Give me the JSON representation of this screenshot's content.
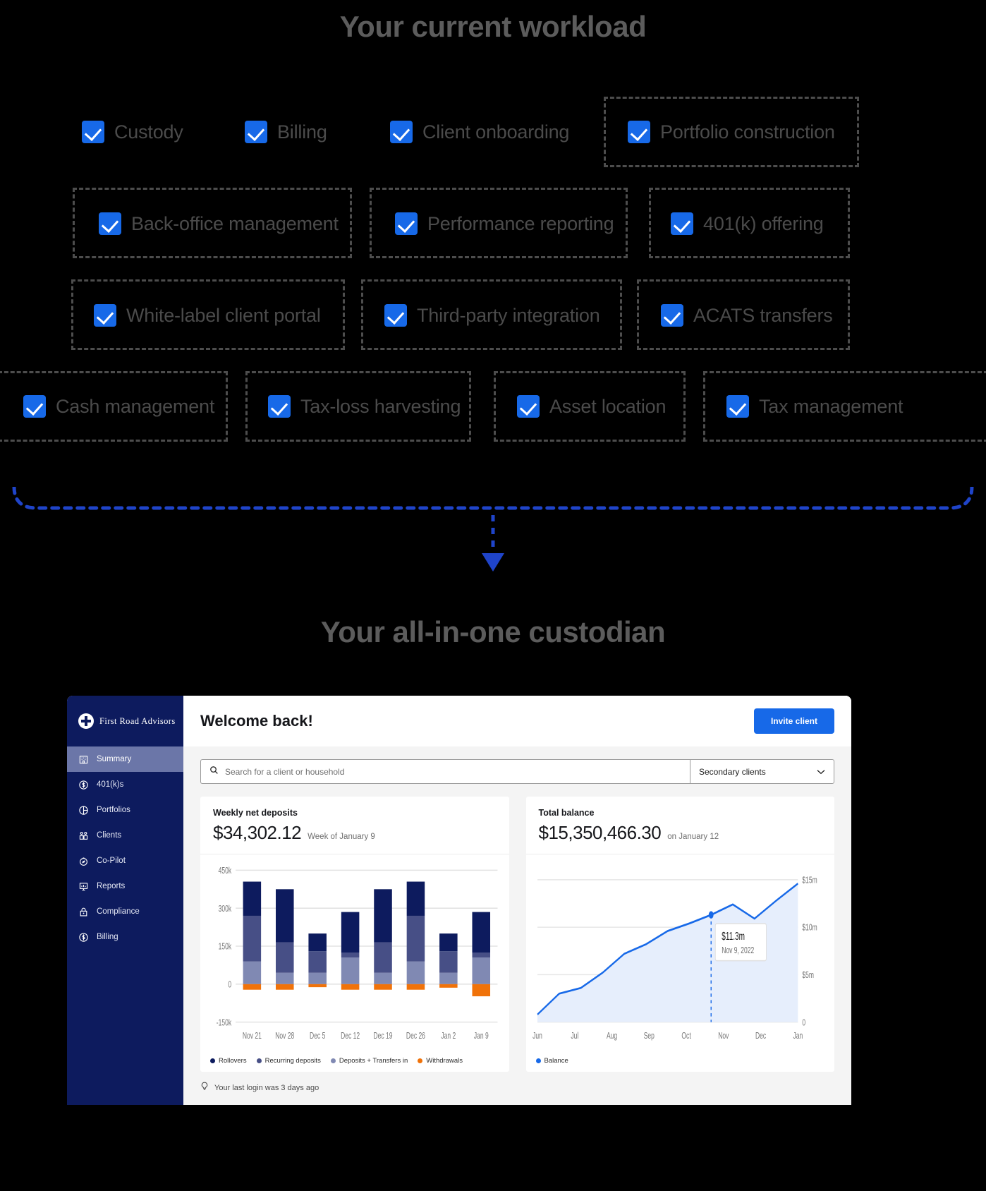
{
  "headings": {
    "workload": "Your current workload",
    "custodian": "Your all-in-one custodian"
  },
  "workload_items": [
    {
      "label": "Custody",
      "boxed": false
    },
    {
      "label": "Billing",
      "boxed": false
    },
    {
      "label": "Client onboarding",
      "boxed": false
    },
    {
      "label": "Portfolio construction",
      "boxed": true
    },
    {
      "label": "Back-office management",
      "boxed": true
    },
    {
      "label": "Performance reporting",
      "boxed": true
    },
    {
      "label": "401(k) offering",
      "boxed": true
    },
    {
      "label": "White-label client portal",
      "boxed": true
    },
    {
      "label": "Third-party integration",
      "boxed": true
    },
    {
      "label": "ACATS transfers",
      "boxed": true
    },
    {
      "label": "Cash management",
      "boxed": true
    },
    {
      "label": "Tax-loss harvesting",
      "boxed": true
    },
    {
      "label": "Asset location",
      "boxed": true
    },
    {
      "label": "Tax management",
      "boxed": true
    }
  ],
  "app": {
    "brand": "First Road Advisors",
    "sidebar": [
      {
        "label": "Summary",
        "icon": "building-icon",
        "active": true
      },
      {
        "label": "401(k)s",
        "icon": "dollar-circle-icon",
        "active": false
      },
      {
        "label": "Portfolios",
        "icon": "pie-chart-icon",
        "active": false
      },
      {
        "label": "Clients",
        "icon": "people-icon",
        "active": false
      },
      {
        "label": "Co-Pilot",
        "icon": "compass-icon",
        "active": false
      },
      {
        "label": "Reports",
        "icon": "presentation-icon",
        "active": false
      },
      {
        "label": "Compliance",
        "icon": "lock-icon",
        "active": false
      },
      {
        "label": "Billing",
        "icon": "dollar-circle-icon",
        "active": false
      }
    ],
    "header": {
      "welcome": "Welcome back!",
      "invite_label": "Invite client"
    },
    "search": {
      "placeholder": "Search for a client or household",
      "icon": "search-icon",
      "filter_value": "Secondary clients",
      "filter_icon": "chevron-down-icon"
    },
    "footer": {
      "icon": "lightbulb-icon",
      "text": "Your last login was 3 days ago"
    },
    "colors": {
      "brand_navy": "#0d1b5e",
      "accent_blue": "#1769e8",
      "orange": "#f07209",
      "series_dark": "#0d1b5e",
      "series_mid": "#474f86",
      "series_light": "#8089b3"
    }
  },
  "chart_data": [
    {
      "type": "bar",
      "title": "Weekly net deposits",
      "value": "$34,302.12",
      "subtitle": "Week of January 9",
      "stacked": true,
      "categories": [
        "Nov 21",
        "Nov 28",
        "Dec 5",
        "Dec 12",
        "Dec 19",
        "Dec 26",
        "Jan 2",
        "Jan 9"
      ],
      "ylabel": "",
      "xlabel": "",
      "ytick_labels": [
        "450k",
        "300k",
        "150k",
        "0",
        "-150k"
      ],
      "ytick_values": [
        450000,
        300000,
        150000,
        0,
        -150000
      ],
      "ylim": [
        -150000,
        450000
      ],
      "grid": true,
      "legend_position": "bottom",
      "series": [
        {
          "name": "Deposits + Transfers in",
          "color": "#8089b3",
          "values": [
            90000,
            45000,
            45000,
            105000,
            45000,
            90000,
            45000,
            105000
          ]
        },
        {
          "name": "Recurring deposits",
          "color": "#474f86",
          "values": [
            180000,
            120000,
            85000,
            20000,
            120000,
            180000,
            85000,
            20000
          ]
        },
        {
          "name": "Rollovers",
          "color": "#0d1b5e",
          "values": [
            135000,
            210000,
            70000,
            160000,
            210000,
            135000,
            70000,
            160000
          ]
        },
        {
          "name": "Withdrawals",
          "color": "#f07209",
          "values": [
            -22000,
            -22000,
            -12000,
            -22000,
            -22000,
            -22000,
            -14000,
            -48000
          ]
        }
      ]
    },
    {
      "type": "area",
      "title": "Total balance",
      "value": "$15,350,466.30",
      "subtitle": "on January 12",
      "categories": [
        "Jun",
        "Jul",
        "Aug",
        "Sep",
        "Oct",
        "Nov",
        "Dec",
        "Jan"
      ],
      "ytick_labels": [
        "$15m",
        "$10m",
        "$5m",
        "0"
      ],
      "ytick_values": [
        15000000,
        10000000,
        5000000,
        0
      ],
      "ylim": [
        0,
        16000000
      ],
      "grid": true,
      "legend_position": "bottom",
      "legend": [
        {
          "name": "Balance",
          "color": "#1769e8"
        }
      ],
      "annotation": {
        "value": "$11.3m",
        "date": "Nov 9, 2022",
        "x_category": "Nov"
      },
      "series": [
        {
          "name": "Balance",
          "color": "#1769e8",
          "x": [
            "Jun",
            "Jun+",
            "Jul",
            "Aug",
            "Aug+",
            "Sep",
            "Oct",
            "Oct+",
            "Nov",
            "Nov+",
            "Dec",
            "Dec+",
            "Jan"
          ],
          "values": [
            800000,
            3000000,
            3600000,
            5200000,
            7200000,
            8200000,
            9600000,
            10400000,
            11300000,
            12400000,
            10900000,
            12800000,
            14600000
          ]
        }
      ]
    }
  ]
}
